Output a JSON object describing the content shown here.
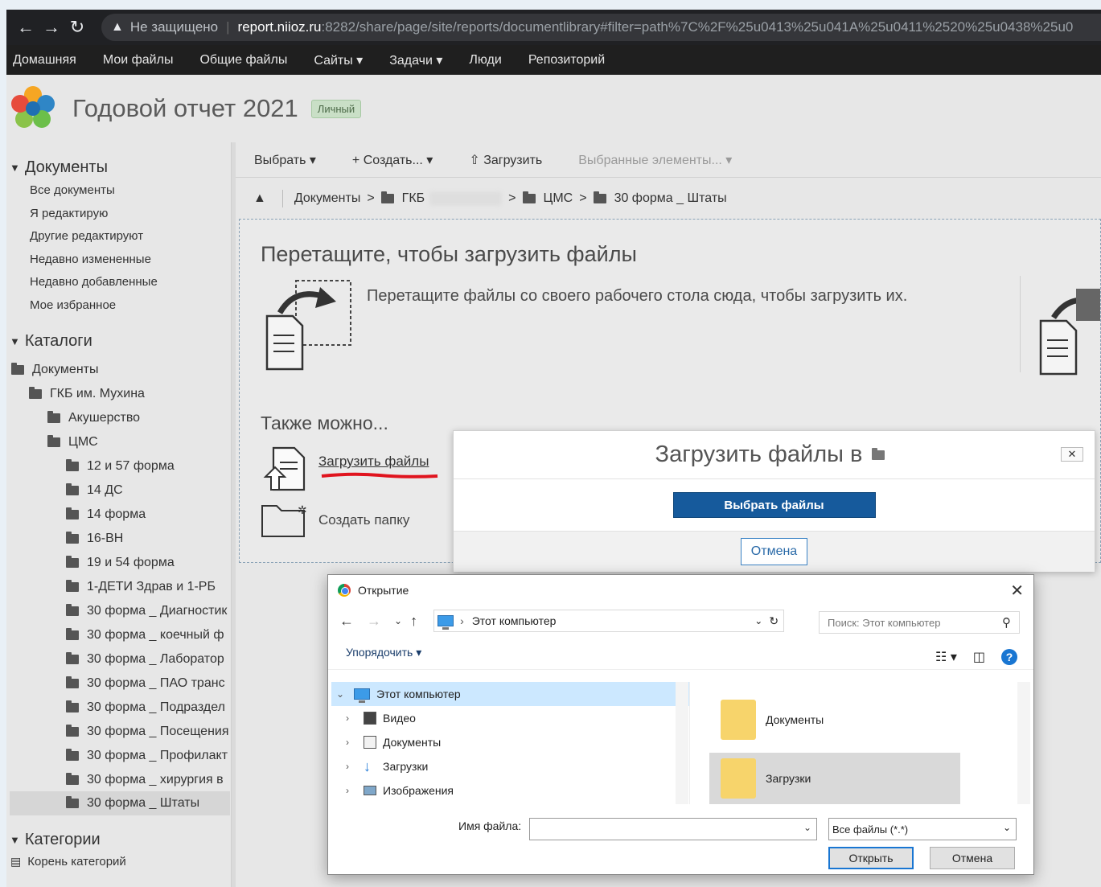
{
  "browser": {
    "security_label": "Не защищено",
    "url_host": "report.niioz.ru",
    "url_rest": ":8282/share/page/site/reports/documentlibrary#filter=path%7C%2F%25u0413%25u041A%25u0411%2520%25u0438%25u0"
  },
  "appnav": [
    "Домашняя",
    "Мои файлы",
    "Общие файлы",
    "Сайты ▾",
    "Задачи ▾",
    "Люди",
    "Репозиторий"
  ],
  "site": {
    "title": "Годовой отчет 2021",
    "badge": "Личный"
  },
  "sidebar": {
    "documents_header": "Документы",
    "documents_links": [
      "Все документы",
      "Я редактирую",
      "Другие редактируют",
      "Недавно измененные",
      "Недавно добавленные",
      "Мое избранное"
    ],
    "catalogs_header": "Каталоги",
    "tree": [
      {
        "label": "Документы",
        "level": 0
      },
      {
        "label": "ГКБ им. Мухина",
        "level": 1
      },
      {
        "label": "Акушерство",
        "level": 2
      },
      {
        "label": "ЦМС",
        "level": 2
      },
      {
        "label": "12 и 57 форма",
        "level": 3
      },
      {
        "label": "14 ДС",
        "level": 3
      },
      {
        "label": "14 форма",
        "level": 3
      },
      {
        "label": "16-ВН",
        "level": 3
      },
      {
        "label": "19 и 54 форма",
        "level": 3
      },
      {
        "label": "1-ДЕТИ Здрав и 1-РБ",
        "level": 3
      },
      {
        "label": "30 форма _ Диагностик",
        "level": 3
      },
      {
        "label": "30 форма _ коечный ф",
        "level": 3
      },
      {
        "label": "30 форма _ Лаборатор",
        "level": 3
      },
      {
        "label": "30 форма _ ПАО транс",
        "level": 3
      },
      {
        "label": "30 форма _ Подраздел",
        "level": 3
      },
      {
        "label": "30 форма _ Посещения",
        "level": 3
      },
      {
        "label": "30 форма _ Профилакт",
        "level": 3
      },
      {
        "label": "30 форма _ хирургия в",
        "level": 3
      },
      {
        "label": "30 форма _ Штаты",
        "level": 3
      }
    ],
    "categories_header": "Категории",
    "categories_root": "Корень категорий"
  },
  "toolbar": {
    "select": "Выбрать ▾",
    "create": "+ Создать... ▾",
    "upload": "Загрузить",
    "selected": "Выбранные элементы... ▾"
  },
  "breadcrumb": {
    "root": "Документы",
    "gkb": "ГКБ",
    "cms": "ЦМС",
    "current": "30 форма _ Штаты"
  },
  "dropzone": {
    "title": "Перетащите, чтобы загрузить файлы",
    "text": "Перетащите файлы со своего рабочего стола сюда, чтобы загрузить их.",
    "also": "Также можно...",
    "upload_link": "Загрузить файлы",
    "create_folder": "Создать папку"
  },
  "upload_dialog": {
    "title": "Загрузить файлы в",
    "close": "✕",
    "choose": "Выбрать файлы",
    "cancel": "Отмена"
  },
  "file_dialog": {
    "title": "Открытие",
    "path": "Этот компьютер",
    "search_placeholder": "Поиск: Этот компьютер",
    "organize": "Упорядочить ▾",
    "tree": [
      "Этот компьютер",
      "Видео",
      "Документы",
      "Загрузки",
      "Изображения"
    ],
    "items": [
      "Документы",
      "Загрузки"
    ],
    "filename_label": "Имя файла:",
    "filter": "Все файлы (*.*)",
    "open": "Открыть",
    "cancel": "Отмена"
  }
}
